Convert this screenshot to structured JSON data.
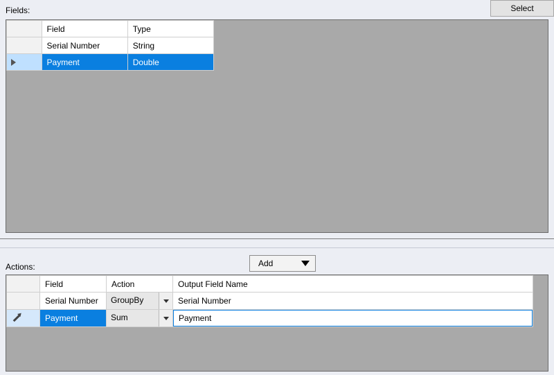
{
  "buttons": {
    "select": "Select",
    "add": "Add"
  },
  "labels": {
    "fields": "Fields:",
    "actions": "Actions:"
  },
  "fields_grid": {
    "headers": {
      "field": "Field",
      "type": "Type"
    },
    "rows": [
      {
        "field": "Serial Number",
        "type": "String",
        "selected": false
      },
      {
        "field": "Payment",
        "type": "Double",
        "selected": true
      }
    ]
  },
  "actions_grid": {
    "headers": {
      "field": "Field",
      "action": "Action",
      "output": "Output Field Name"
    },
    "rows": [
      {
        "field": "Serial Number",
        "action": "GroupBy",
        "output": "Serial Number",
        "editing": false
      },
      {
        "field": "Payment",
        "action": "Sum",
        "output": "Payment",
        "editing": true
      }
    ]
  }
}
